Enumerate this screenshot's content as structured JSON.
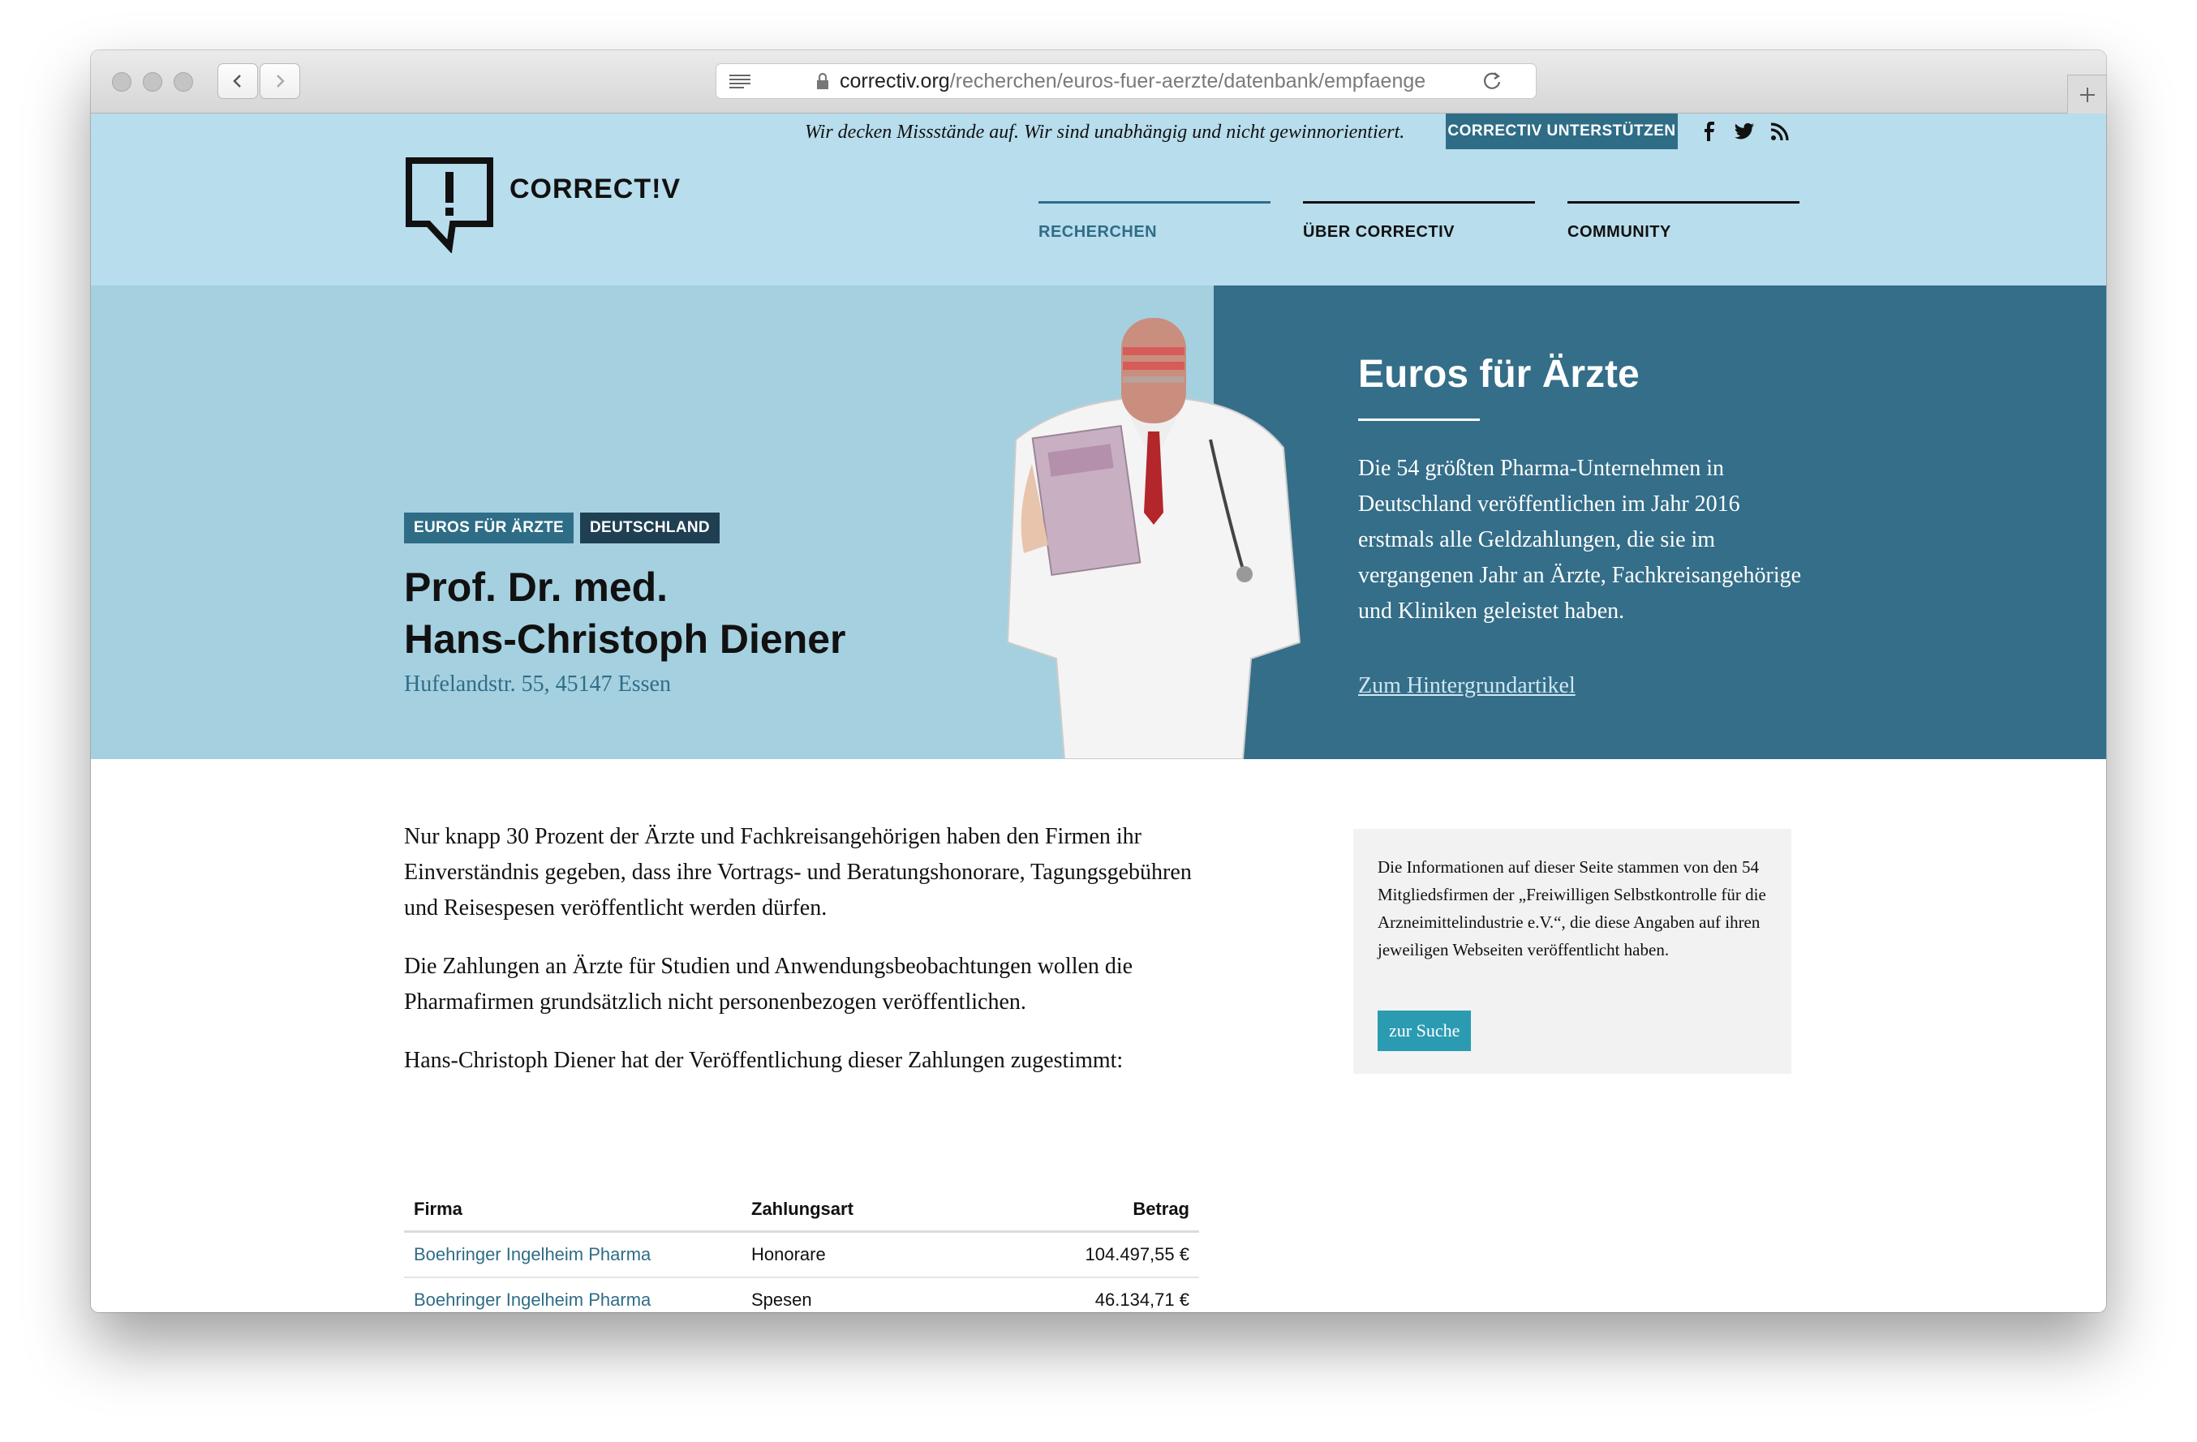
{
  "browser": {
    "url_host": "correctiv.org",
    "url_path": "/recherchen/euros-fuer-aerzte/datenbank/empfaenge"
  },
  "header": {
    "tagline": "Wir decken Missstände auf. Wir sind unabhängig und nicht gewinnorientiert.",
    "support_label": "CORRECTIV UNTERSTÜTZEN",
    "logo_text": "CORRECT!V",
    "nav": [
      {
        "label": "RECHERCHEN"
      },
      {
        "label": "ÜBER CORRECTIV"
      },
      {
        "label": "COMMUNITY"
      }
    ],
    "social_icons": [
      "facebook-icon",
      "twitter-icon",
      "rss-icon"
    ]
  },
  "hero": {
    "tags": [
      "EUROS FÜR ÄRZTE",
      "DEUTSCHLAND"
    ],
    "name_line1": "Prof. Dr. med.",
    "name_line2": "Hans-Christoph Diener",
    "address": "Hufelandstr. 55, 45147 Essen",
    "title": "Euros für Ärzte",
    "text": "Die 54 größten Pharma-Unternehmen in Deutschland veröffentlichen im Jahr 2016 erstmals alle Geldzahlungen, die sie im vergangenen Jahr an Ärzte, Fachkreisangehörige und Kliniken geleistet haben.",
    "link": "Zum Hintergrundartikel"
  },
  "content": {
    "p1": "Nur knapp 30 Prozent der Ärzte und Fachkreisangehörigen haben den Firmen ihr Einverständnis gegeben, dass ihre Vortrags- und Beratungshonorare, Tagungsgebühren und Reisespesen veröffentlicht werden dürfen.",
    "p2": "Die Zahlungen an Ärzte für Studien und Anwendungsbeobachtungen wollen die Pharmafirmen grundsätzlich nicht personenbezogen veröffentlichen.",
    "p3": "Hans-Christoph Diener hat der Veröffentlichung dieser Zahlungen zugestimmt:"
  },
  "infobox": {
    "text": "Die Informationen auf dieser Seite stammen von den 54 Mitgliedsfirmen der „Freiwilligen Selbstkontrolle für die Arzneimittelindustrie e.V.“, die diese Angaben auf ihren jeweiligen Webseiten veröffentlicht haben.",
    "button": "zur Suche"
  },
  "table": {
    "headers": [
      "Firma",
      "Zahlungsart",
      "Betrag"
    ],
    "rows": [
      {
        "firma": "Boehringer Ingelheim Pharma",
        "art": "Honorare",
        "betrag": "104.497,55 €"
      },
      {
        "firma": "Boehringer Ingelheim Pharma",
        "art": "Spesen",
        "betrag": "46.134,71 €"
      }
    ]
  },
  "colors": {
    "header_bg": "#b8ddec",
    "hero_bg": "#a5d0e0",
    "accent": "#2f6d87",
    "hero_panel": "#346e89",
    "button": "#2b9bb2"
  }
}
